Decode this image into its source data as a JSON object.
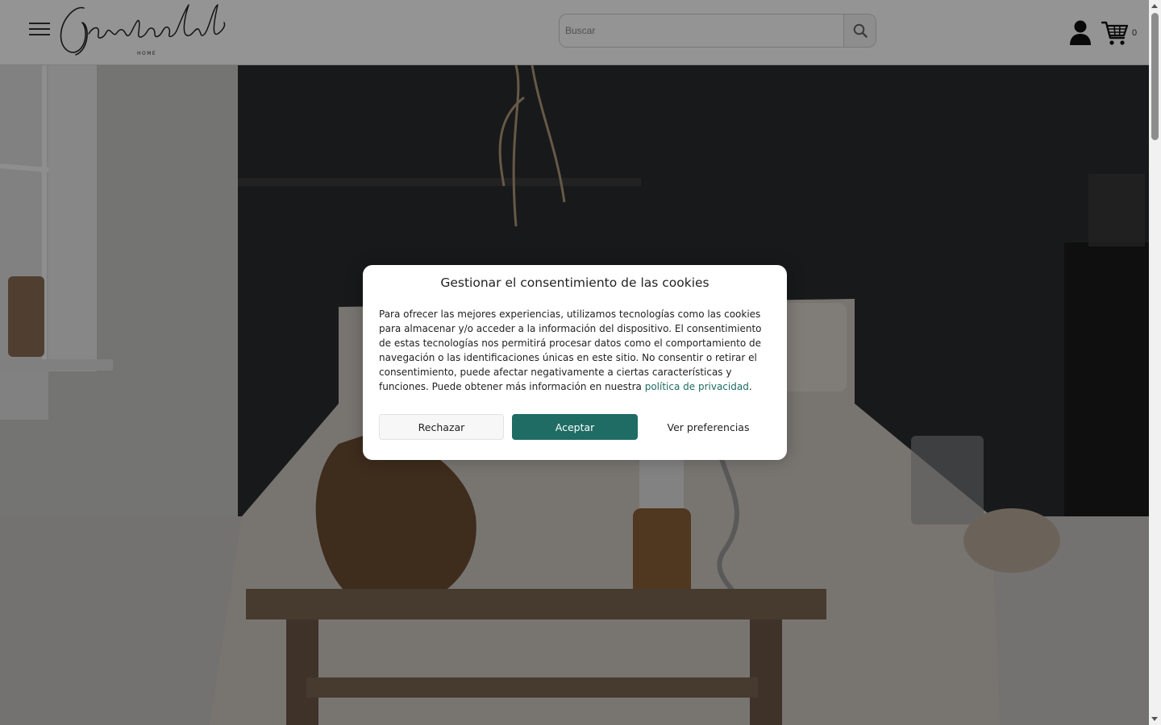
{
  "header": {
    "logo_text": "Gastroclub",
    "logo_subtext": "HOME",
    "search": {
      "placeholder": "Buscar",
      "value": ""
    },
    "cart_count": "0"
  },
  "icons": {
    "menu": "hamburger-menu-icon",
    "search": "magnifier-icon",
    "account": "user-icon",
    "cart": "shopping-cart-icon"
  },
  "hero": {
    "image": "dark bedroom interior with bed, wooden bench, vase and dried flowers"
  },
  "cookie_dialog": {
    "title": "Gestionar el consentimiento de las cookies",
    "body_text": "Para ofrecer las mejores experiencias, utilizamos tecnologías como las cookies para almacenar y/o acceder a la información del dispositivo. El consentimiento de estas tecnologías nos permitirá procesar datos como el comportamiento de navegación o las identificaciones únicas en este sitio. No consentir o retirar el consentimiento, puede afectar negativamente a ciertas características y funciones. Puede obtener más información en nuestra ",
    "privacy_link": "política de privacidad",
    "body_end": ".",
    "buttons": {
      "reject": "Rechazar",
      "accept": "Aceptar",
      "preferences": "Ver preferencias"
    }
  },
  "colors": {
    "accent": "#1e6c64",
    "overlay": "rgba(0,0,0,0.42)"
  }
}
